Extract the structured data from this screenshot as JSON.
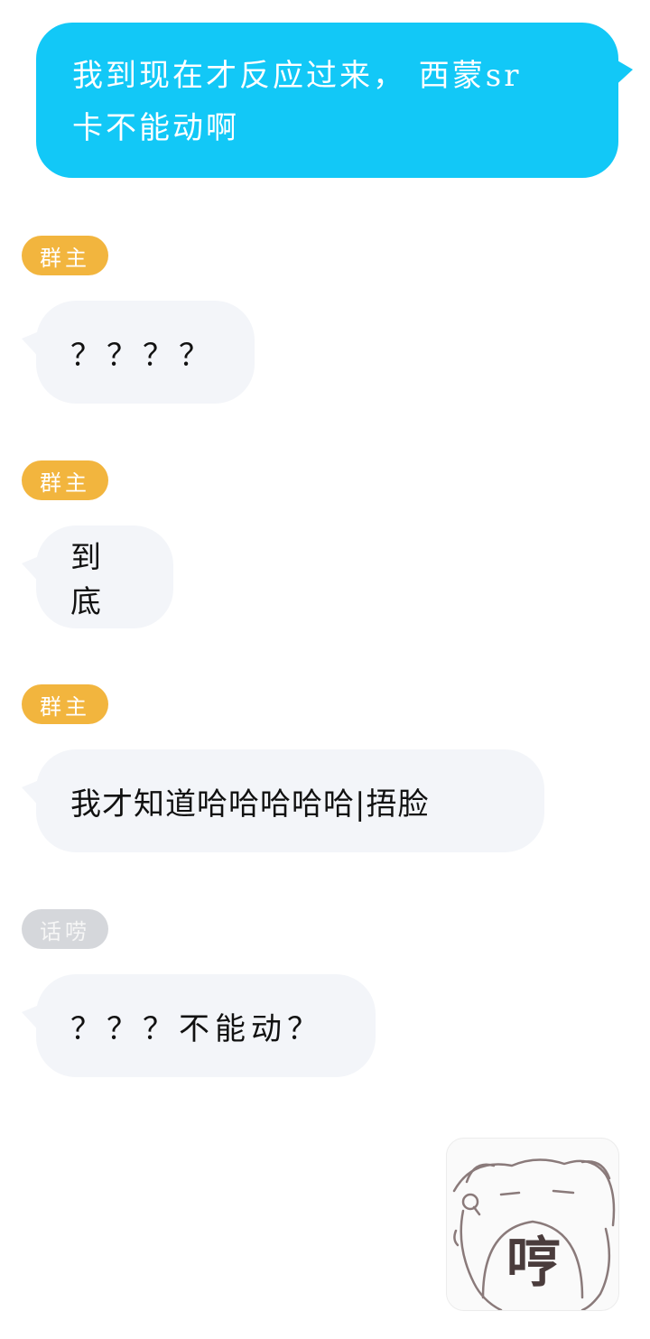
{
  "messages": [
    {
      "sender": "self",
      "text_line1": "我到现在才反应过来， 西蒙sr",
      "text_line2": "卡不能动啊"
    },
    {
      "badge": "群主",
      "text": "？？？？"
    },
    {
      "badge": "群主",
      "text": "到底"
    },
    {
      "badge": "群主",
      "text": "我才知道哈哈哈哈哈|捂脸"
    },
    {
      "badge": "话唠",
      "text": "？？？不能动？"
    }
  ],
  "sticker": {
    "text": "哼",
    "icon": "pig-face-sticker"
  },
  "colors": {
    "outgoing": "#12c8f7",
    "incoming": "#f3f5f9",
    "owner_badge": "#f2b53e",
    "chatty_badge": "#d5d7db"
  }
}
